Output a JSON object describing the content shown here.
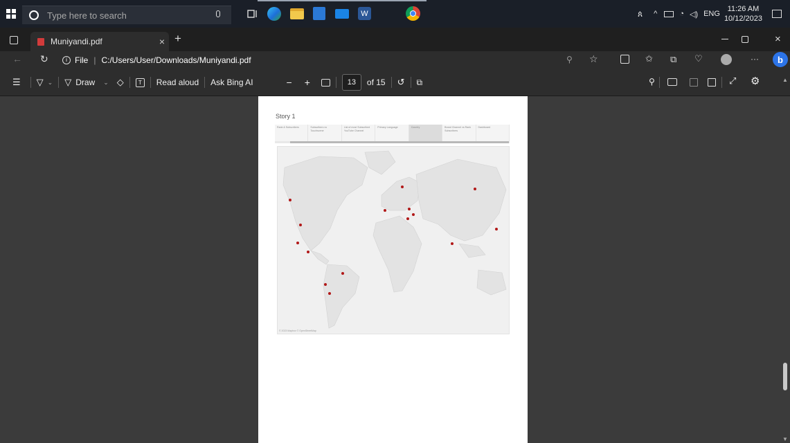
{
  "taskbar": {
    "search_placeholder": "Type here to search",
    "tray_lang": "ENG",
    "time": "11:26 AM",
    "date": "10/12/2023"
  },
  "browser": {
    "tab_title": "Muniyandi.pdf",
    "tab_close": "×",
    "new_tab": "+",
    "address_scheme": "File",
    "address_separator": "|",
    "address_url": "C:/Users/User/Downloads/Muniyandi.pdf",
    "more_label": "···"
  },
  "pdf_toolbar": {
    "draw_label": "Draw",
    "read_aloud_label": "Read aloud",
    "ask_bing_label": "Ask Bing AI",
    "zoom_out": "−",
    "zoom_in": "+",
    "current_page": "13",
    "page_total": "of 15"
  },
  "document": {
    "story_title": "Story 1",
    "story_tabs": [
      {
        "label": "Rank & Subscribers",
        "active": false
      },
      {
        "label": "Subscribers vs Touchscene",
        "active": false
      },
      {
        "label": "List of most Subscribed YouTube Channel",
        "active": false
      },
      {
        "label": "Primary Language",
        "active": false
      },
      {
        "label": "Country",
        "active": true
      },
      {
        "label": "Brand Channel vs Rank Subscribers",
        "active": false
      },
      {
        "label": "Dashboard",
        "active": false
      }
    ],
    "map_credit": "© 2023 Mapbox © OpenStreetMap"
  },
  "colors": {
    "marker": "#b11818",
    "land": "#e3e3e3",
    "water": "#f0f0f0"
  },
  "scroll": {
    "position": 0.83
  }
}
